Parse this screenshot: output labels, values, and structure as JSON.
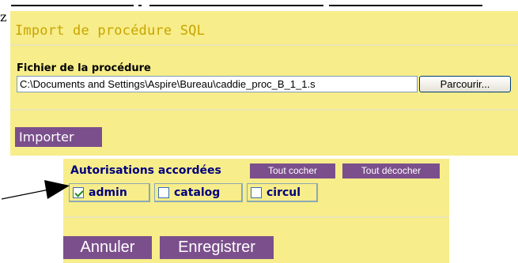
{
  "partial_char": "z",
  "import_panel": {
    "title": "Import de procédure SQL",
    "file_label": "Fichier de la procédure",
    "file_value": "C:\\Documents and Settings\\Aspire\\Bureau\\caddie_proc_B_1_1.s",
    "browse_label": "Parcourir...",
    "import_label": "Importer"
  },
  "auth_panel": {
    "title": "Autorisations accordées",
    "check_all": "Tout cocher",
    "uncheck_all": "Tout décocher",
    "items": [
      {
        "label": "admin",
        "checked": true
      },
      {
        "label": "catalog",
        "checked": false
      },
      {
        "label": "circul",
        "checked": false
      }
    ],
    "cancel_label": "Annuler",
    "save_label": "Enregistrer"
  },
  "colors": {
    "panel_bg": "#f7ed8a",
    "button_bg": "#7b4f8c",
    "title_color": "#c8a400",
    "label_navy": "#00007c"
  }
}
